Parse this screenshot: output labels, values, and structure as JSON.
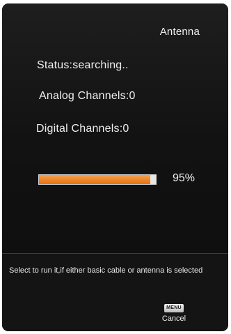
{
  "menu": {
    "title": "Antenna"
  },
  "scan": {
    "status_label": "Status:",
    "status_value": "searching..",
    "analog_label": "Analog Channels:",
    "analog_count": "0",
    "digital_label": "Digital Channels:",
    "digital_count": "0",
    "progress_percent_text": "95%",
    "progress_fraction": 0.95
  },
  "help": {
    "text": "Select to run it,if either basic cable or antenna is selected"
  },
  "controls": {
    "menu_key_label": "MENU",
    "cancel_label": "Cancel"
  },
  "colors": {
    "panel_background": "#171717",
    "progress_fill": "#f08a2e",
    "progress_track": "#e6e6e6",
    "text": "#eeeeee"
  }
}
